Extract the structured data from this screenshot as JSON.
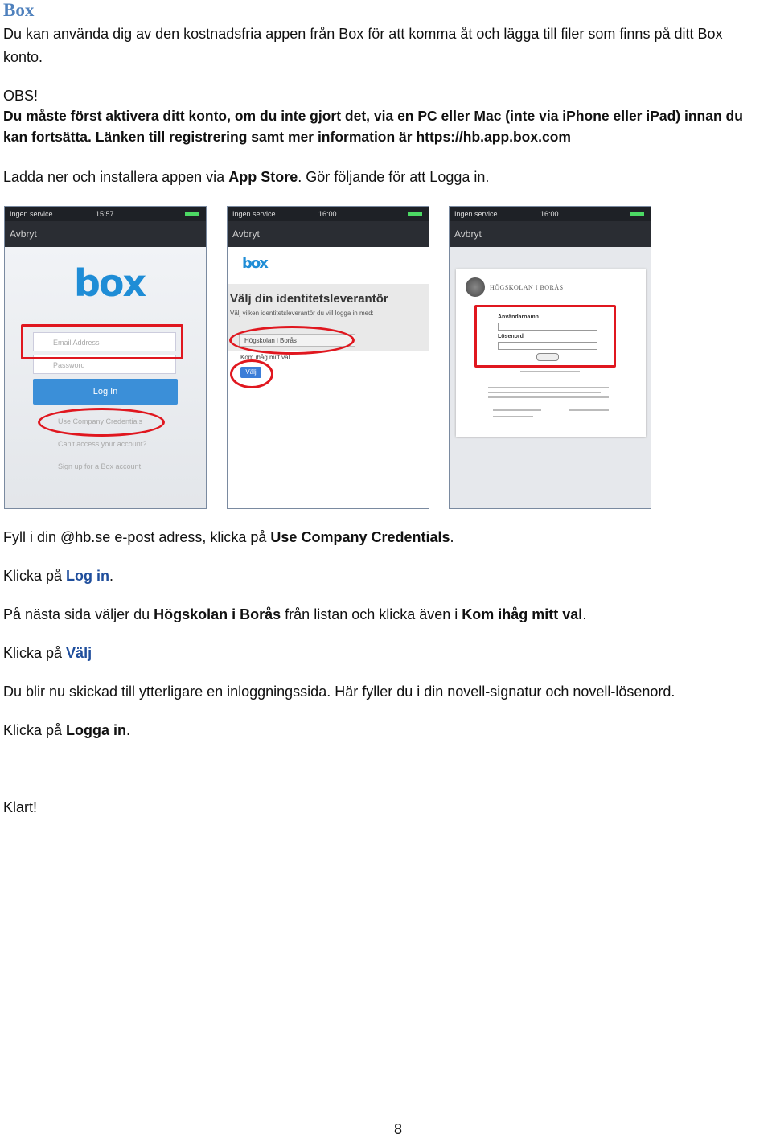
{
  "heading": "Box",
  "p1": "Du kan använda dig av den kostnadsfria appen från Box för att komma åt och lägga till filer som finns på ditt Box",
  "p1b": "konto.",
  "obs": "OBS!",
  "obs1": "Du måste först aktivera ditt konto, om du inte gjort det, via en PC eller Mac (inte via iPhone eller iPad) innan du",
  "obs2": "kan fortsätta. Länken till registrering samt mer information är https://hb.app.box.com",
  "install_pre": "Ladda ner och installera appen via ",
  "install_store": "App Store",
  "install_post": ". Gör följande för att Logga in.",
  "phones": [
    {
      "status_left": "Ingen service",
      "status_time": "15:57",
      "nav": "Avbryt",
      "logo": "box",
      "email_placeholder": "Email Address",
      "password_placeholder": "Password",
      "login": "Log In",
      "use_company": "Use Company Credentials",
      "cant_access": "Can't access your account?",
      "signup": "Sign up for a Box account"
    },
    {
      "status_left": "Ingen service",
      "status_time": "16:00",
      "nav": "Avbryt",
      "logo": "box",
      "title": "Välj din identitetsleverantör",
      "subtitle": "Välj vilken identitetsleverantör du vill logga in med:",
      "select": "Högskolan i Borås",
      "remember": "Kom ihåg mitt val",
      "valj": "Välj"
    },
    {
      "status_left": "Ingen service",
      "status_time": "16:00",
      "nav": "Avbryt",
      "org": "HÖGSKOLAN I BORÅS",
      "user_label": "Användarnamn",
      "pass_label": "Lösenord"
    }
  ],
  "step1_pre": "Fyll i din @hb.se e-post adress, klicka på ",
  "step1_b": "Use Company Credentials",
  "step1_post": ".",
  "step2_pre": "Klicka på ",
  "step2_b": "Log in",
  "step2_post": ".",
  "step3_pre": "På nästa sida väljer du ",
  "step3_b1": "Högskolan i Borås",
  "step3_mid": " från listan och klicka även i ",
  "step3_b2": "Kom ihåg mitt val",
  "step3_post": ".",
  "step4_pre": "Klicka på ",
  "step4_b": "Välj",
  "step5": "Du blir nu skickad till ytterligare en inloggningssida. Här fyller du i din novell-signatur och novell-lösenord.",
  "step6_pre": "Klicka på ",
  "step6_b": "Logga in",
  "step6_post": ".",
  "done": "Klart!",
  "page_number": "8"
}
